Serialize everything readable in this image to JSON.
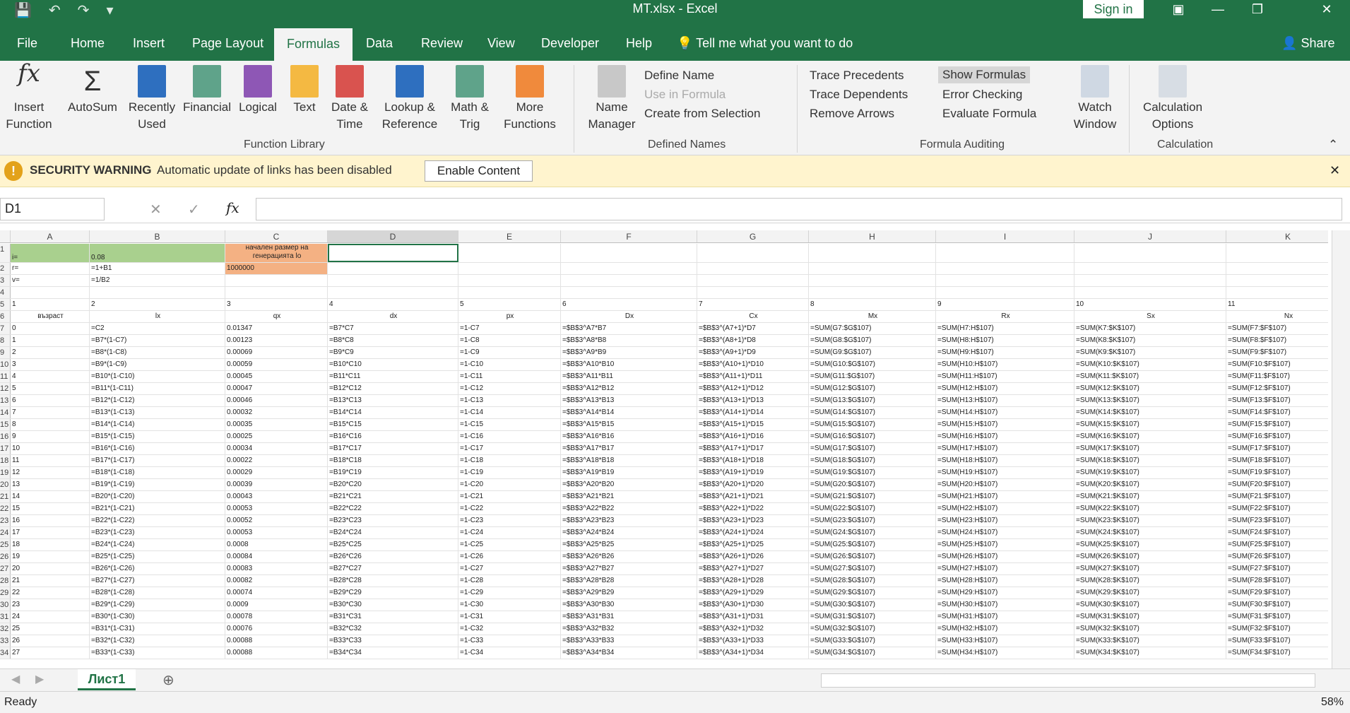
{
  "window": {
    "title": "MT.xlsx  -  Excel",
    "sign_in": "Sign in"
  },
  "tabs": [
    "File",
    "Home",
    "Insert",
    "Page Layout",
    "Formulas",
    "Data",
    "Review",
    "View",
    "Developer",
    "Help"
  ],
  "tell_me": "Tell me what you want to do",
  "share": "Share",
  "ribbon": {
    "function_library": {
      "label": "Function Library",
      "buttons": [
        "Insert Function",
        "AutoSum",
        "Recently Used",
        "Financial",
        "Logical",
        "Text",
        "Date & Time",
        "Lookup & Reference",
        "Math & Trig",
        "More Functions"
      ]
    },
    "defined_names": {
      "label": "Defined Names",
      "name_manager": "Name Manager",
      "define_name": "Define Name",
      "use_in_formula": "Use in Formula",
      "create_from_selection": "Create from Selection"
    },
    "formula_auditing": {
      "label": "Formula Auditing",
      "trace_precedents": "Trace Precedents",
      "trace_dependents": "Trace Dependents",
      "remove_arrows": "Remove Arrows",
      "show_formulas": "Show Formulas",
      "error_checking": "Error Checking",
      "evaluate_formula": "Evaluate Formula",
      "watch_window": "Watch Window"
    },
    "calculation": {
      "label": "Calculation",
      "options": "Calculation Options"
    }
  },
  "security_warning": {
    "title": "SECURITY WARNING",
    "message": "Automatic update of links has been disabled",
    "button": "Enable Content"
  },
  "formula_bar": {
    "name_box": "D1",
    "fx": "fx",
    "value": ""
  },
  "columns": [
    "A",
    "B",
    "C",
    "D",
    "E",
    "F",
    "G",
    "H",
    "I",
    "J",
    "K"
  ],
  "rows": [
    {
      "n": "1",
      "cells": [
        "i=",
        "0.08",
        "начален размер на генерацията lo",
        "",
        "",
        "",
        "",
        "",
        "",
        "",
        ""
      ]
    },
    {
      "n": "2",
      "cells": [
        "r=",
        "=1+B1",
        "1000000",
        "",
        "",
        "",
        "",
        "",
        "",
        "",
        ""
      ]
    },
    {
      "n": "3",
      "cells": [
        "v=",
        "=1/B2",
        "",
        "",
        "",
        "",
        "",
        "",
        "",
        "",
        ""
      ]
    },
    {
      "n": "4",
      "cells": [
        "",
        "",
        "",
        "",
        "",
        "",
        "",
        "",
        "",
        "",
        ""
      ]
    },
    {
      "n": "5",
      "cells": [
        "1",
        "2",
        "3",
        "4",
        "5",
        "6",
        "7",
        "8",
        "9",
        "10",
        "11"
      ]
    },
    {
      "n": "6",
      "cells": [
        "възраст",
        "lx",
        "qx",
        "dx",
        "px",
        "Dx",
        "Cx",
        "Mx",
        "Rx",
        "Sx",
        "Nx"
      ]
    },
    {
      "n": "7",
      "cells": [
        "0",
        "=C2",
        "0.01347",
        "=B7*C7",
        "=1-C7",
        "=$B$3^A7*B7",
        "=$B$3^(A7+1)*D7",
        "=SUM(G7:$G$107)",
        "=SUM(H7:H$107)",
        "=SUM(K7:$K$107)",
        "=SUM(F7:$F$107)"
      ]
    },
    {
      "n": "8",
      "cells": [
        "1",
        "=B7*(1-C7)",
        "0.00123",
        "=B8*C8",
        "=1-C8",
        "=$B$3^A8*B8",
        "=$B$3^(A8+1)*D8",
        "=SUM(G8:$G$107)",
        "=SUM(H8:H$107)",
        "=SUM(K8:$K$107)",
        "=SUM(F8:$F$107)"
      ]
    },
    {
      "n": "9",
      "cells": [
        "2",
        "=B8*(1-C8)",
        "0.00069",
        "=B9*C9",
        "=1-C9",
        "=$B$3^A9*B9",
        "=$B$3^(A9+1)*D9",
        "=SUM(G9:$G$107)",
        "=SUM(H9:H$107)",
        "=SUM(K9:$K$107)",
        "=SUM(F9:$F$107)"
      ]
    },
    {
      "n": "10",
      "cells": [
        "3",
        "=B9*(1-C9)",
        "0.00059",
        "=B10*C10",
        "=1-C10",
        "=$B$3^A10*B10",
        "=$B$3^(A10+1)*D10",
        "=SUM(G10:$G$107)",
        "=SUM(H10:H$107)",
        "=SUM(K10:$K$107)",
        "=SUM(F10:$F$107)"
      ]
    },
    {
      "n": "11",
      "cells": [
        "4",
        "=B10*(1-C10)",
        "0.00045",
        "=B11*C11",
        "=1-C11",
        "=$B$3^A11*B11",
        "=$B$3^(A11+1)*D11",
        "=SUM(G11:$G$107)",
        "=SUM(H11:H$107)",
        "=SUM(K11:$K$107)",
        "=SUM(F11:$F$107)"
      ]
    },
    {
      "n": "12",
      "cells": [
        "5",
        "=B11*(1-C11)",
        "0.00047",
        "=B12*C12",
        "=1-C12",
        "=$B$3^A12*B12",
        "=$B$3^(A12+1)*D12",
        "=SUM(G12:$G$107)",
        "=SUM(H12:H$107)",
        "=SUM(K12:$K$107)",
        "=SUM(F12:$F$107)"
      ]
    },
    {
      "n": "13",
      "cells": [
        "6",
        "=B12*(1-C12)",
        "0.00046",
        "=B13*C13",
        "=1-C13",
        "=$B$3^A13*B13",
        "=$B$3^(A13+1)*D13",
        "=SUM(G13:$G$107)",
        "=SUM(H13:H$107)",
        "=SUM(K13:$K$107)",
        "=SUM(F13:$F$107)"
      ]
    },
    {
      "n": "14",
      "cells": [
        "7",
        "=B13*(1-C13)",
        "0.00032",
        "=B14*C14",
        "=1-C14",
        "=$B$3^A14*B14",
        "=$B$3^(A14+1)*D14",
        "=SUM(G14:$G$107)",
        "=SUM(H14:H$107)",
        "=SUM(K14:$K$107)",
        "=SUM(F14:$F$107)"
      ]
    },
    {
      "n": "15",
      "cells": [
        "8",
        "=B14*(1-C14)",
        "0.00035",
        "=B15*C15",
        "=1-C15",
        "=$B$3^A15*B15",
        "=$B$3^(A15+1)*D15",
        "=SUM(G15:$G$107)",
        "=SUM(H15:H$107)",
        "=SUM(K15:$K$107)",
        "=SUM(F15:$F$107)"
      ]
    },
    {
      "n": "16",
      "cells": [
        "9",
        "=B15*(1-C15)",
        "0.00025",
        "=B16*C16",
        "=1-C16",
        "=$B$3^A16*B16",
        "=$B$3^(A16+1)*D16",
        "=SUM(G16:$G$107)",
        "=SUM(H16:H$107)",
        "=SUM(K16:$K$107)",
        "=SUM(F16:$F$107)"
      ]
    },
    {
      "n": "17",
      "cells": [
        "10",
        "=B16*(1-C16)",
        "0.00034",
        "=B17*C17",
        "=1-C17",
        "=$B$3^A17*B17",
        "=$B$3^(A17+1)*D17",
        "=SUM(G17:$G$107)",
        "=SUM(H17:H$107)",
        "=SUM(K17:$K$107)",
        "=SUM(F17:$F$107)"
      ]
    },
    {
      "n": "18",
      "cells": [
        "11",
        "=B17*(1-C17)",
        "0.00022",
        "=B18*C18",
        "=1-C18",
        "=$B$3^A18*B18",
        "=$B$3^(A18+1)*D18",
        "=SUM(G18:$G$107)",
        "=SUM(H18:H$107)",
        "=SUM(K18:$K$107)",
        "=SUM(F18:$F$107)"
      ]
    },
    {
      "n": "19",
      "cells": [
        "12",
        "=B18*(1-C18)",
        "0.00029",
        "=B19*C19",
        "=1-C19",
        "=$B$3^A19*B19",
        "=$B$3^(A19+1)*D19",
        "=SUM(G19:$G$107)",
        "=SUM(H19:H$107)",
        "=SUM(K19:$K$107)",
        "=SUM(F19:$F$107)"
      ]
    },
    {
      "n": "20",
      "cells": [
        "13",
        "=B19*(1-C19)",
        "0.00039",
        "=B20*C20",
        "=1-C20",
        "=$B$3^A20*B20",
        "=$B$3^(A20+1)*D20",
        "=SUM(G20:$G$107)",
        "=SUM(H20:H$107)",
        "=SUM(K20:$K$107)",
        "=SUM(F20:$F$107)"
      ]
    },
    {
      "n": "21",
      "cells": [
        "14",
        "=B20*(1-C20)",
        "0.00043",
        "=B21*C21",
        "=1-C21",
        "=$B$3^A21*B21",
        "=$B$3^(A21+1)*D21",
        "=SUM(G21:$G$107)",
        "=SUM(H21:H$107)",
        "=SUM(K21:$K$107)",
        "=SUM(F21:$F$107)"
      ]
    },
    {
      "n": "22",
      "cells": [
        "15",
        "=B21*(1-C21)",
        "0.00053",
        "=B22*C22",
        "=1-C22",
        "=$B$3^A22*B22",
        "=$B$3^(A22+1)*D22",
        "=SUM(G22:$G$107)",
        "=SUM(H22:H$107)",
        "=SUM(K22:$K$107)",
        "=SUM(F22:$F$107)"
      ]
    },
    {
      "n": "23",
      "cells": [
        "16",
        "=B22*(1-C22)",
        "0.00052",
        "=B23*C23",
        "=1-C23",
        "=$B$3^A23*B23",
        "=$B$3^(A23+1)*D23",
        "=SUM(G23:$G$107)",
        "=SUM(H23:H$107)",
        "=SUM(K23:$K$107)",
        "=SUM(F23:$F$107)"
      ]
    },
    {
      "n": "24",
      "cells": [
        "17",
        "=B23*(1-C23)",
        "0.00053",
        "=B24*C24",
        "=1-C24",
        "=$B$3^A24*B24",
        "=$B$3^(A24+1)*D24",
        "=SUM(G24:$G$107)",
        "=SUM(H24:H$107)",
        "=SUM(K24:$K$107)",
        "=SUM(F24:$F$107)"
      ]
    },
    {
      "n": "25",
      "cells": [
        "18",
        "=B24*(1-C24)",
        "0.0008",
        "=B25*C25",
        "=1-C25",
        "=$B$3^A25*B25",
        "=$B$3^(A25+1)*D25",
        "=SUM(G25:$G$107)",
        "=SUM(H25:H$107)",
        "=SUM(K25:$K$107)",
        "=SUM(F25:$F$107)"
      ]
    },
    {
      "n": "26",
      "cells": [
        "19",
        "=B25*(1-C25)",
        "0.00084",
        "=B26*C26",
        "=1-C26",
        "=$B$3^A26*B26",
        "=$B$3^(A26+1)*D26",
        "=SUM(G26:$G$107)",
        "=SUM(H26:H$107)",
        "=SUM(K26:$K$107)",
        "=SUM(F26:$F$107)"
      ]
    },
    {
      "n": "27",
      "cells": [
        "20",
        "=B26*(1-C26)",
        "0.00083",
        "=B27*C27",
        "=1-C27",
        "=$B$3^A27*B27",
        "=$B$3^(A27+1)*D27",
        "=SUM(G27:$G$107)",
        "=SUM(H27:H$107)",
        "=SUM(K27:$K$107)",
        "=SUM(F27:$F$107)"
      ]
    },
    {
      "n": "28",
      "cells": [
        "21",
        "=B27*(1-C27)",
        "0.00082",
        "=B28*C28",
        "=1-C28",
        "=$B$3^A28*B28",
        "=$B$3^(A28+1)*D28",
        "=SUM(G28:$G$107)",
        "=SUM(H28:H$107)",
        "=SUM(K28:$K$107)",
        "=SUM(F28:$F$107)"
      ]
    },
    {
      "n": "29",
      "cells": [
        "22",
        "=B28*(1-C28)",
        "0.00074",
        "=B29*C29",
        "=1-C29",
        "=$B$3^A29*B29",
        "=$B$3^(A29+1)*D29",
        "=SUM(G29:$G$107)",
        "=SUM(H29:H$107)",
        "=SUM(K29:$K$107)",
        "=SUM(F29:$F$107)"
      ]
    },
    {
      "n": "30",
      "cells": [
        "23",
        "=B29*(1-C29)",
        "0.0009",
        "=B30*C30",
        "=1-C30",
        "=$B$3^A30*B30",
        "=$B$3^(A30+1)*D30",
        "=SUM(G30:$G$107)",
        "=SUM(H30:H$107)",
        "=SUM(K30:$K$107)",
        "=SUM(F30:$F$107)"
      ]
    },
    {
      "n": "31",
      "cells": [
        "24",
        "=B30*(1-C30)",
        "0.00078",
        "=B31*C31",
        "=1-C31",
        "=$B$3^A31*B31",
        "=$B$3^(A31+1)*D31",
        "=SUM(G31:$G$107)",
        "=SUM(H31:H$107)",
        "=SUM(K31:$K$107)",
        "=SUM(F31:$F$107)"
      ]
    },
    {
      "n": "32",
      "cells": [
        "25",
        "=B31*(1-C31)",
        "0.00076",
        "=B32*C32",
        "=1-C32",
        "=$B$3^A32*B32",
        "=$B$3^(A32+1)*D32",
        "=SUM(G32:$G$107)",
        "=SUM(H32:H$107)",
        "=SUM(K32:$K$107)",
        "=SUM(F32:$F$107)"
      ]
    },
    {
      "n": "33",
      "cells": [
        "26",
        "=B32*(1-C32)",
        "0.00088",
        "=B33*C33",
        "=1-C33",
        "=$B$3^A33*B33",
        "=$B$3^(A33+1)*D33",
        "=SUM(G33:$G$107)",
        "=SUM(H33:H$107)",
        "=SUM(K33:$K$107)",
        "=SUM(F33:$F$107)"
      ]
    },
    {
      "n": "34",
      "cells": [
        "27",
        "=B33*(1-C33)",
        "0.00088",
        "=B34*C34",
        "=1-C34",
        "=$B$3^A34*B34",
        "=$B$3^(A34+1)*D34",
        "=SUM(G34:$G$107)",
        "=SUM(H34:H$107)",
        "=SUM(K34:$K$107)",
        "=SUM(F34:$F$107)"
      ]
    }
  ],
  "sheet_tab": "Лист1",
  "status": {
    "ready": "Ready",
    "zoom": "58%"
  },
  "colors": {
    "excel_green": "#217346",
    "row1_fill_ab": "#a9d08e",
    "row1_fill_c": "#f4b183",
    "warning_bg": "#fff4ce"
  }
}
